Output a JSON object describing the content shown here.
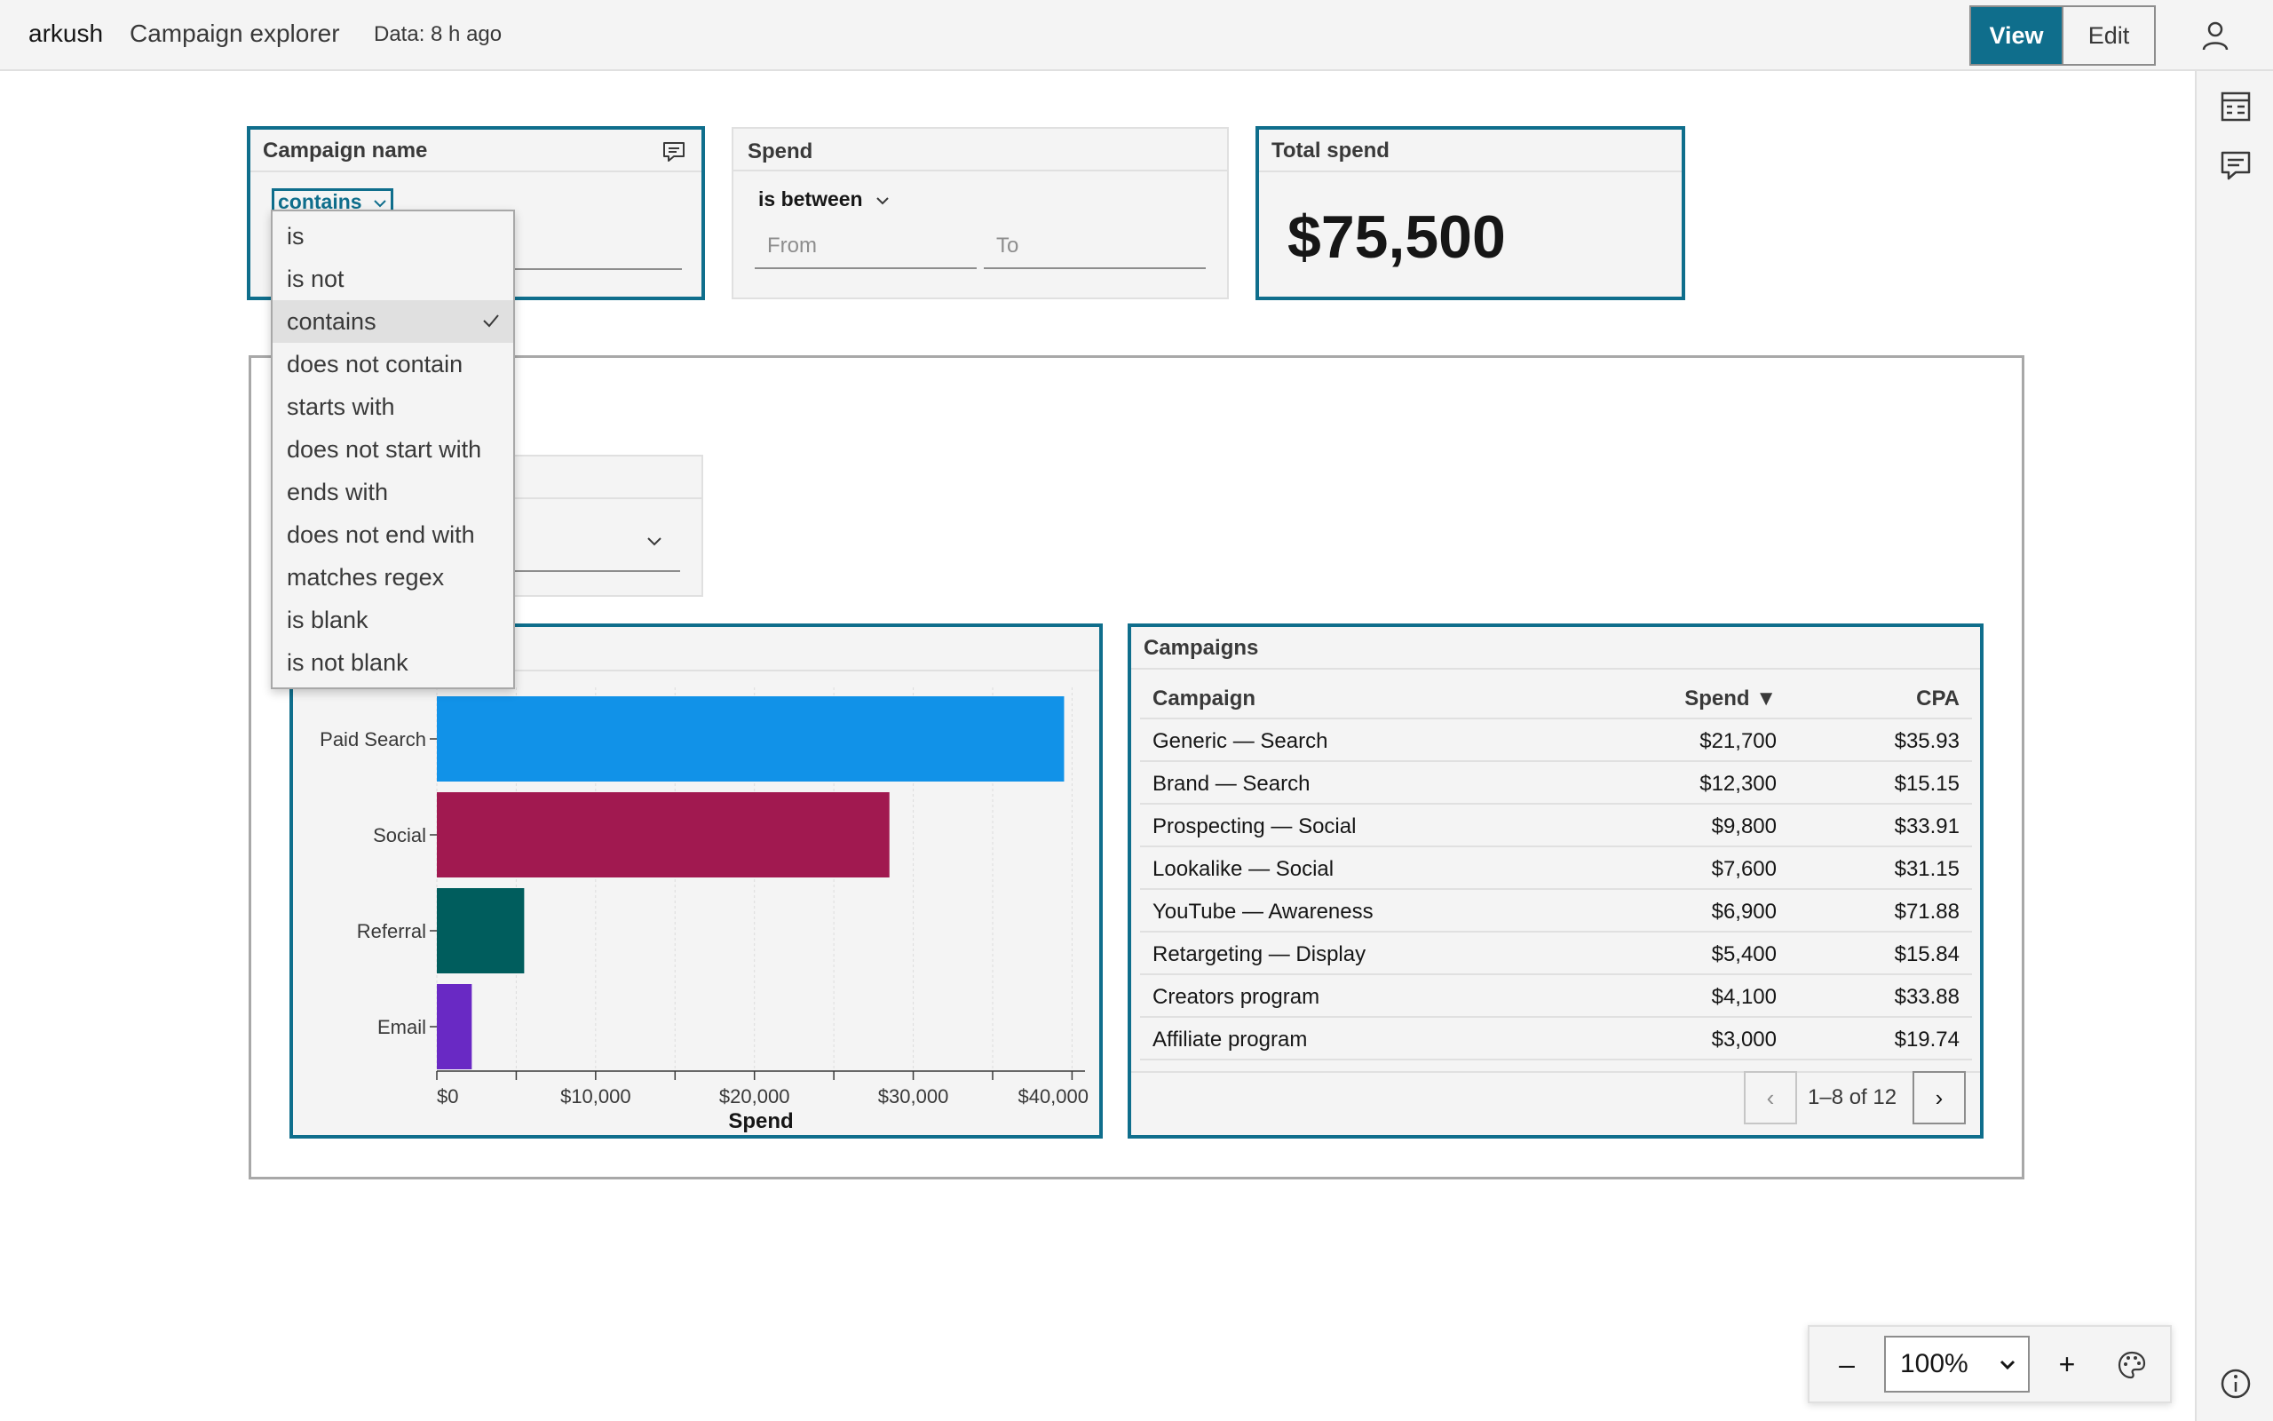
{
  "header": {
    "brand": "arkush",
    "title": "Campaign explorer",
    "data_age": "Data: 8 h ago",
    "view_label": "View",
    "edit_label": "Edit"
  },
  "filters": {
    "campaign_name": {
      "title": "Campaign name",
      "operator": "contains",
      "operator_options": [
        "is",
        "is not",
        "contains",
        "does not contain",
        "starts with",
        "does not start with",
        "ends with",
        "does not end with",
        "matches regex",
        "is blank",
        "is not blank"
      ],
      "selected_index": 2
    },
    "spend": {
      "title": "Spend",
      "operator": "is between",
      "from_placeholder": "From",
      "to_placeholder": "To"
    }
  },
  "kpi": {
    "title": "Total spend",
    "value": "$75,500"
  },
  "chart_data": {
    "type": "bar",
    "orientation": "horizontal",
    "categories": [
      "Paid Search",
      "Social",
      "Referral",
      "Email"
    ],
    "values": [
      39500,
      28500,
      5500,
      2200
    ],
    "colors": [
      "#1192e8",
      "#a11950",
      "#005d5d",
      "#6929c4"
    ],
    "xlabel": "Spend",
    "xlim": [
      0,
      40000
    ],
    "xticks": [
      "$0",
      "$10,000",
      "$20,000",
      "$30,000",
      "$40,000"
    ],
    "grid": true
  },
  "table": {
    "title": "Campaigns",
    "columns": [
      "Campaign",
      "Spend ▼",
      "CPA"
    ],
    "rows": [
      [
        "Generic — Search",
        "$21,700",
        "$35.93"
      ],
      [
        "Brand — Search",
        "$12,300",
        "$15.15"
      ],
      [
        "Prospecting — Social",
        "$9,800",
        "$33.91"
      ],
      [
        "Lookalike — Social",
        "$7,600",
        "$31.15"
      ],
      [
        "YouTube — Awareness",
        "$6,900",
        "$71.88"
      ],
      [
        "Retargeting — Display",
        "$5,400",
        "$15.84"
      ],
      [
        "Creators program",
        "$4,100",
        "$33.88"
      ],
      [
        "Affiliate program",
        "$3,000",
        "$19.74"
      ]
    ],
    "pager": {
      "prev": "‹",
      "range": "1–8 of 12",
      "next": "›"
    }
  },
  "zoom": {
    "minus": "–",
    "value": "100%",
    "plus": "+"
  },
  "icons": {
    "user": "user-icon",
    "table": "table-icon",
    "comment": "comment-icon",
    "palette": "palette-icon",
    "info": "info-icon"
  },
  "accent": "#0f6e8c"
}
